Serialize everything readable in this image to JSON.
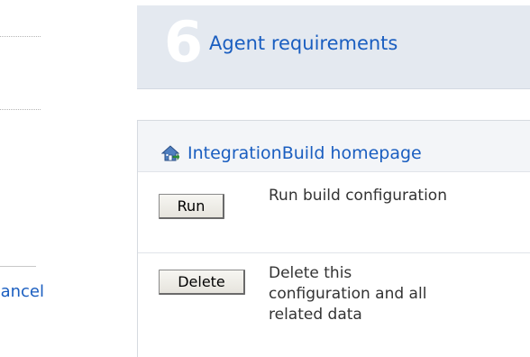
{
  "left_column": {
    "cancel_link": "Cancel"
  },
  "step": {
    "number": "6",
    "title": "Agent requirements"
  },
  "actions": {
    "homepage_link": "IntegrationBuild homepage",
    "homepage_icon": "home-icon",
    "items": [
      {
        "button_label": "Run",
        "description": "Run build configuration"
      },
      {
        "button_label": "Delete",
        "description": "Delete this configuration and all related data"
      }
    ]
  },
  "colors": {
    "link": "#1a5ec0",
    "step_box_bg": "#e4e9f0",
    "panel_header_bg": "#f3f5f8"
  }
}
